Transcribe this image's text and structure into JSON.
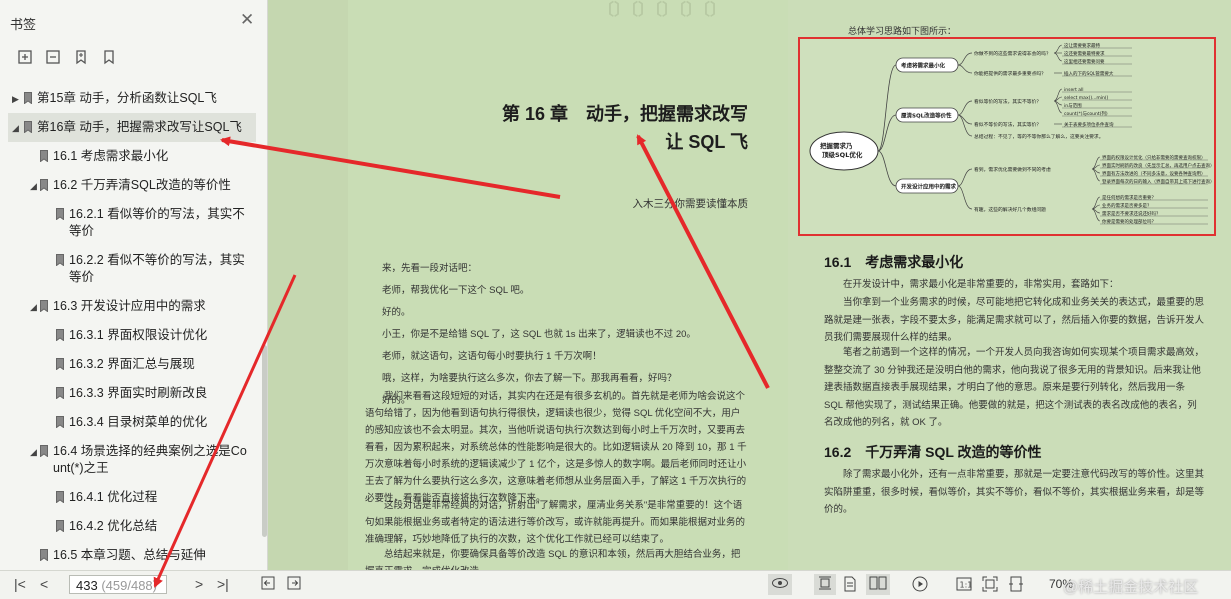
{
  "sidebar": {
    "title": "书签",
    "close_icon": "close-icon",
    "tools": [
      "expand-all-icon",
      "collapse-all-icon",
      "add-bookmark-icon",
      "bookmark-icon"
    ],
    "items": [
      {
        "label": "第15章 动手，分析函数让SQL飞",
        "level": 0,
        "state": "collapsed"
      },
      {
        "label": "第16章 动手，把握需求改写让SQL飞",
        "level": 0,
        "state": "expanded",
        "selected": true
      },
      {
        "label": "16.1 考虑需求最小化",
        "level": 1,
        "state": "leaf"
      },
      {
        "label": "16.2 千万弄清SQL改造的等价性",
        "level": 1,
        "state": "expanded"
      },
      {
        "label": "16.2.1 看似等价的写法，其实不",
        "label2": "等价",
        "level": 2,
        "state": "leaf"
      },
      {
        "label": "16.2.2 看似不等价的写法，其实",
        "label2": "等价",
        "level": 2,
        "state": "leaf"
      },
      {
        "label": "16.3 开发设计应用中的需求",
        "level": 1,
        "state": "expanded"
      },
      {
        "label": "16.3.1 界面权限设计优化",
        "level": 2,
        "state": "leaf"
      },
      {
        "label": "16.3.2 界面汇总与展现",
        "level": 2,
        "state": "leaf"
      },
      {
        "label": "16.3.3 界面实时刷新改良",
        "level": 2,
        "state": "leaf"
      },
      {
        "label": "16.3.4 目录树菜单的优化",
        "level": 2,
        "state": "leaf"
      },
      {
        "label": "16.4 场景选择的经典案例之选是Co",
        "label2": "unt(*)之王",
        "level": 1,
        "state": "expanded"
      },
      {
        "label": "16.4.1 优化过程",
        "level": 2,
        "state": "leaf"
      },
      {
        "label": "16.4.2 优化总结",
        "level": 2,
        "state": "leaf"
      },
      {
        "label": "16.5 本章习题、总结与延伸",
        "level": 1,
        "state": "leaf"
      }
    ]
  },
  "left_page": {
    "chapter_title_1": "第 16 章　动手，把握需求改写",
    "chapter_title_2": "让 SQL 飞",
    "epigraph": "入木三分你需要读懂本质",
    "dialog": [
      "来，先看一段对话吧：",
      "老师，帮我优化一下这个 SQL 吧。",
      "好的。",
      "小王，你是不是给错 SQL 了，这 SQL 也就 1s 出来了，逻辑读也不过 20。",
      "老师，就这语句，这语句每小时要执行 1 千万次啊！",
      "哦，这样，为啥要执行这么多次，你去了解一下。那我再看看，好吗？",
      "好的。"
    ],
    "para1": "我们来看看这段短短的对话，其实内在还是有很多玄机的。首先就是老师为啥会说这个语句给错了，因为他看到语句执行得很快，逻辑读也很少，觉得 SQL 优化空间不大，用户的感知应该也不会太明显。其次，当他听说语句执行次数达到每小时上千万次时，又要再去看看，因为累积起来，对系统总体的性能影响是很大的。比如逻辑读从 20 降到 10，那 1 千万次意味着每小时系统的逻辑读减少了 1 亿个，这是多惊人的数字啊。最后老师同时还让小王去了解为什么要执行这么多次，这意味着老师想从业务层面入手，了解这 1 千万次执行的必要性，看看能否直接将执行次数降下来。",
    "para2": "这段对话是非常经典的对话，折射出\"了解需求，厘清业务关系\"是非常重要的！这个语句如果能根据业务或者特定的语法进行等价改写，或许就能再提升。而如果能根据对业务的准确理解，巧妙地降低了执行的次数，这个优化工作就已经可以结束了。",
    "para3": "总结起来就是，你要确保具备等价改造 SQL 的意识和本领，然后再大胆结合业务，把握真正需求，完成优化改造。"
  },
  "right_page": {
    "figure_caption": "总体学习思路如下图所示：",
    "mindmap": {
      "root": "把握需求乃顶级SQL优化",
      "branches": [
        {
          "label": "考虑将需求最小化",
          "children": [
            {
              "label": "你做不到的这些需求说得非会的吗？",
              "leaves": [
                "这让需要要求最特",
                "这还要需要最特要求",
                "这里相还要需要问要"
              ]
            },
            {
              "label": "你能把提供的需求最多重要点吗？",
              "leaves": [
                "插入的下的SQL管需要大"
              ]
            }
          ]
        },
        {
          "label": "厘清SQL改造等价性",
          "children": [
            {
              "label": "看似等价的写法，其实不等价？",
              "leaves": [
                "insert all",
                "select max()...min()",
                "in与范围",
                "count(*)与count(列)"
              ]
            },
            {
              "label": "看似不等价的写法，其实等价？",
              "leaves": [
                "关于表要多项位条件查询"
              ]
            },
            {
              "label": "总结过程：不见了，等的不等你那么了解么，这要关注要求。",
              "leaves": []
            }
          ]
        },
        {
          "label": "开发设计应用中的需求",
          "children": [
            {
              "label": "看到，需求优化需要做到不同的考虑",
              "leaves": [
                "界面的权限设计优化（只给非需要的需要查询权限）",
                "界面实时刷新的改良（先显示汇总，再选用户点击查询）",
                "界面有方法改进的（不同多法意，设要各种查询用）",
                "登录界面每次的日的输入（界面自带其上或下进行查询）"
              ]
            },
            {
              "label": "有趣，这些的解决好几个数组问题",
              "leaves": [
                "是任何想的需求是否重要？",
                "业务的需求是否要多是？",
                "需求是否不要求还说还好吗？",
                "你要是需要的处理部位吗？"
              ]
            }
          ]
        }
      ]
    },
    "section1_title": "16.1　考虑需求最小化",
    "s1_p1": "在开发设计中，需求最小化是非常重要的，非常实用，套路如下：",
    "s1_p2": "当你拿到一个业务需求的时候，尽可能地把它转化成和业务关关的表达式，最重要的思路就是建一张表，字段不要太多，能满足需求就可以了，然后插入你要的数据，告诉开发人员我们需要展现什么样的结果。",
    "s1_p3": "笔者之前遇到一个这样的情况，一个开发人员向我咨询如何实现某个项目需求最高效，整整交流了 30 分钟我还是没明白他的需求，他向我说了很多无用的背景知识。后来我让他建表插数据直接表手展现结果，才明白了他的意思。原来是要行列转化，然后我用一条 SQL 帮他实现了，测试结果正确。他要做的就是，把这个测试表的表名改成他的表名，列名改成他的列名，就 OK 了。",
    "section2_title": "16.2　千万弄清 SQL 改造的等价性",
    "s2_p1": "除了需求最小化外，还有一点非常重要，那就是一定要注意代码改写的等价性。这里其实陷阱重重，很多时候，看似等价，其实不等价，看似不等价，其实根据业务来看，却是等价的。"
  },
  "bottombar": {
    "current_page": "433",
    "page_total": "(459/488)",
    "zoom": "70%"
  },
  "watermark": "@稀土掘金技术社区",
  "colors": {
    "annotation_red": "#e5282a",
    "reader_bg": "#c5d7b0"
  }
}
